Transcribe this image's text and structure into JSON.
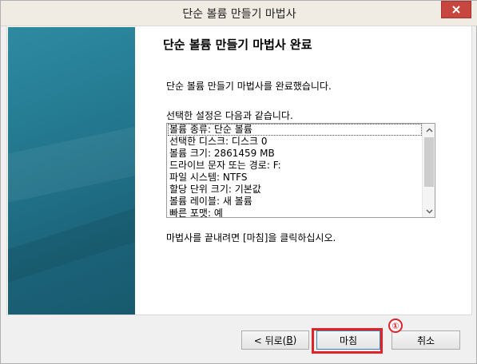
{
  "window": {
    "title": "단순 볼륨 만들기 마법사"
  },
  "wizard": {
    "heading": "단순 볼륨 만들기 마법사 완료",
    "completed_message": "단순 볼륨 만들기 마법사를 완료했습니다.",
    "settings_intro": "선택한 설정은 다음과 같습니다.",
    "settings": [
      "볼륨 종류: 단순 볼륨",
      "선택한 디스크: 디스크 0",
      "볼륨 크기: 2861459 MB",
      "드라이브 문자 또는 경로: F:",
      "파일 시스템: NTFS",
      "할당 단위 크기: 기본값",
      "볼륨 레이블: 새 볼륨",
      "빠른 포맷: 예"
    ],
    "finish_instruction": "마법사를 끝내려면 [마침]을 클릭하십시오."
  },
  "buttons": {
    "back": "< 뒤로(",
    "back_mnemonic": "B",
    "back_suffix": ")",
    "finish": "마침",
    "cancel": "취소"
  },
  "annotation": {
    "marker": "①",
    "color": "#e0222a"
  }
}
